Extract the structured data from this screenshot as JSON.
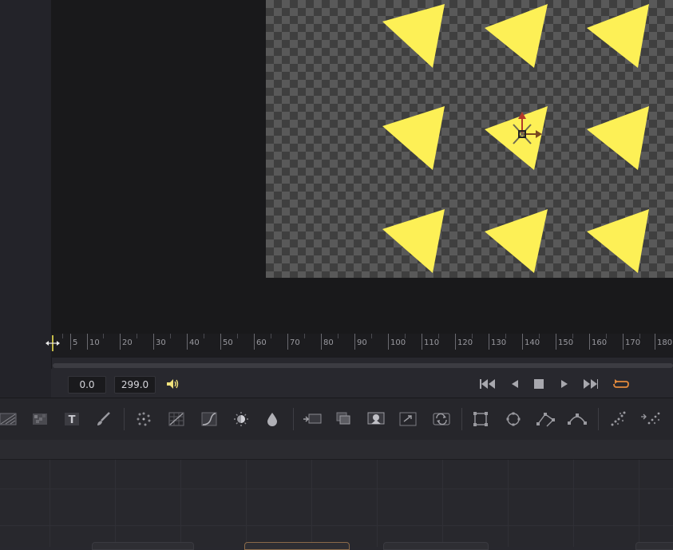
{
  "viewer": {
    "checker_light": "#595959",
    "checker_dark": "#3f3f3f",
    "triangle_color": "#fdf056",
    "triangle_count": 9,
    "transform_widget": "transform-gizmo"
  },
  "ruler": {
    "ticks": [
      "5",
      "10",
      "20",
      "30",
      "40",
      "50",
      "60",
      "70",
      "80",
      "90",
      "100",
      "110",
      "120",
      "130",
      "140",
      "150",
      "160",
      "170",
      "180"
    ]
  },
  "transport": {
    "start_time": "0.0",
    "end_time": "299.0",
    "accent_color": "#e38a3c",
    "buttons": [
      "volume-icon",
      "skip-to-start-icon",
      "play-reverse-icon",
      "stop-icon",
      "play-icon",
      "skip-to-end-icon",
      "loop-icon"
    ]
  },
  "toolbar": {
    "tools": [
      "background-icon",
      "fast-noise-icon",
      "text-icon",
      "paint-icon",
      "particles-icon",
      "color-corrector-icon",
      "color-curves-icon",
      "hue-curves-icon",
      "blur-icon",
      "merge-icon",
      "channel-boolean-icon",
      "matte-control-icon",
      "resize-icon",
      "transform-icon",
      "rectangle-mask-icon",
      "ellipse-mask-icon",
      "polygon-mask-icon",
      "bspline-mask-icon",
      "pemitter-icon",
      "prender-icon"
    ]
  }
}
